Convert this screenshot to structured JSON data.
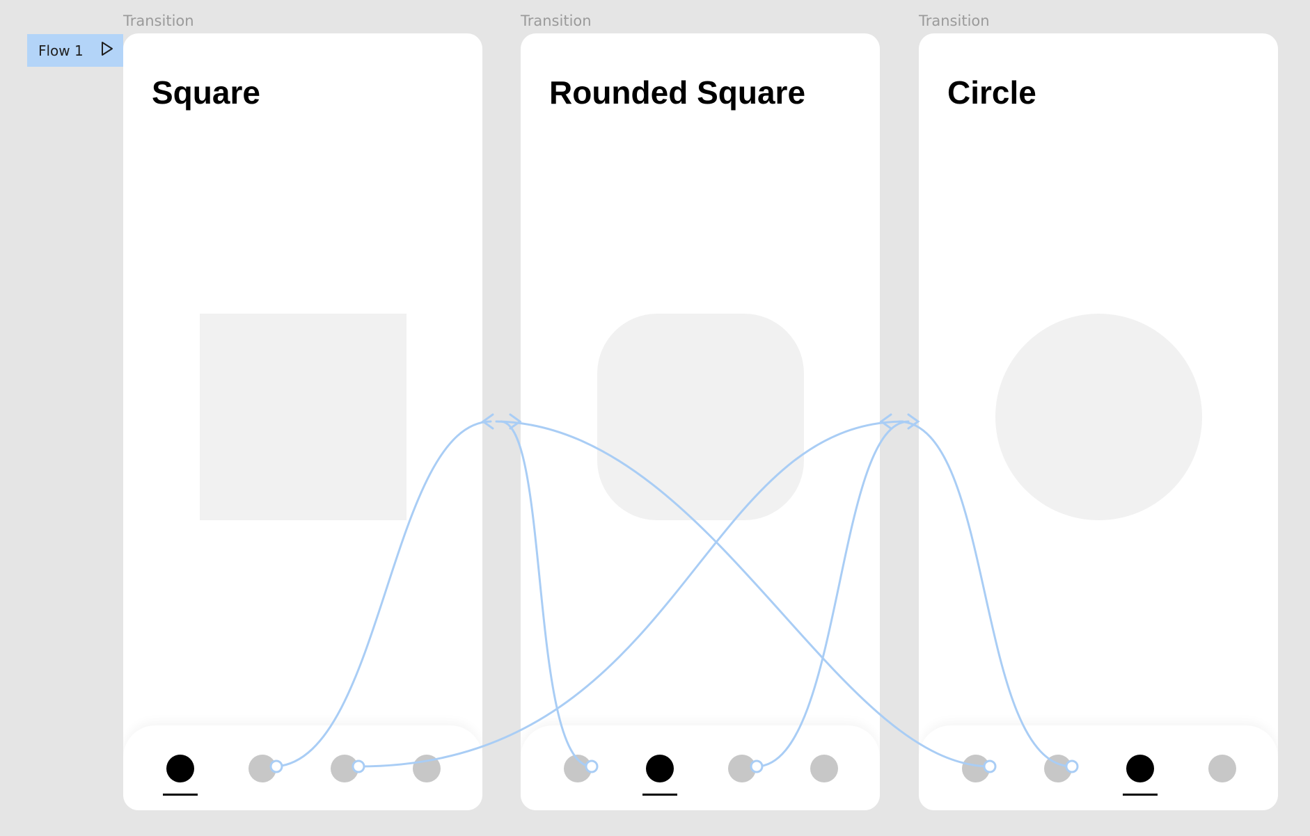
{
  "frame_labels": [
    "Transition",
    "Transition",
    "Transition"
  ],
  "flow": {
    "label": "Flow 1",
    "icon": "play-icon"
  },
  "frames": [
    {
      "title": "Square",
      "shape": "square",
      "active_tab": 1
    },
    {
      "title": "Rounded Square",
      "shape": "rounded-square",
      "active_tab": 2
    },
    {
      "title": "Circle",
      "shape": "circle",
      "active_tab": 3
    }
  ],
  "tabs_per_frame": 4,
  "colors": {
    "canvas": "#e5e5e5",
    "flow_tag": "#b3d4f8",
    "connector": "#a9cdf5",
    "active_dot": "#000000",
    "inactive_dot": "#c7c7c7",
    "shape_fill": "#f1f1f1"
  }
}
